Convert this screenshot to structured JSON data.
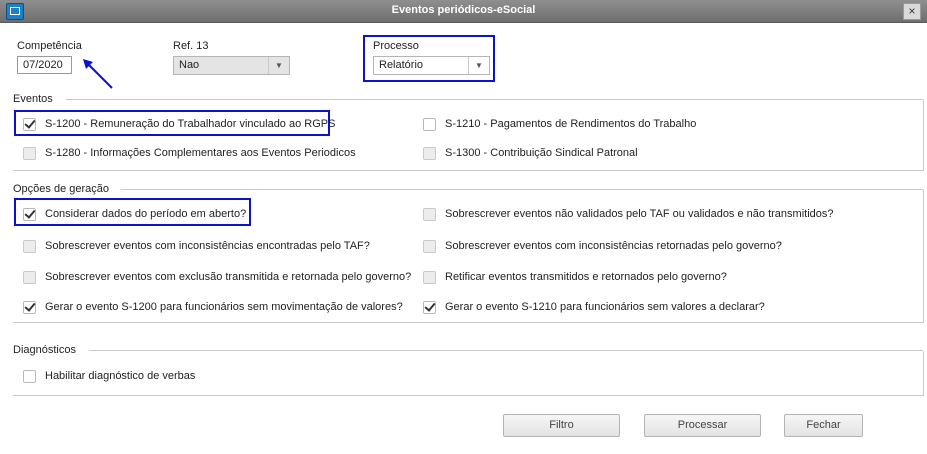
{
  "window": {
    "title": "Eventos periódicos-eSocial",
    "close_label": "×"
  },
  "fields": {
    "competencia": {
      "label": "Competência",
      "value": "07/2020"
    },
    "ref13": {
      "label": "Ref. 13",
      "value": "Nao"
    },
    "processo": {
      "label": "Processo",
      "value": "Relatório"
    }
  },
  "sections": {
    "eventos": {
      "title": "Eventos",
      "items": [
        {
          "label": "S-1200 - Remuneração do Trabalhador vinculado ao RGPS",
          "checked": true,
          "enabled": true
        },
        {
          "label": "S-1210 - Pagamentos de Rendimentos do Trabalho",
          "checked": false,
          "enabled": true
        },
        {
          "label": "S-1280 - Informações Complementares aos Eventos Periodicos",
          "checked": false,
          "enabled": false
        },
        {
          "label": "S-1300 - Contribuição Sindical Patronal",
          "checked": false,
          "enabled": false
        }
      ]
    },
    "opcoes": {
      "title": "Opções de geração",
      "items": [
        {
          "label": "Considerar dados do período em aberto?",
          "checked": true,
          "enabled": true
        },
        {
          "label": "Sobrescrever eventos não validados pelo TAF ou validados e não transmitidos?",
          "checked": false,
          "enabled": false
        },
        {
          "label": "Sobrescrever eventos com inconsistências encontradas pelo TAF?",
          "checked": false,
          "enabled": false
        },
        {
          "label": "Sobrescrever eventos com inconsistências retornadas pelo governo?",
          "checked": false,
          "enabled": false
        },
        {
          "label": "Sobrescrever eventos com exclusão transmitida e retornada pelo governo?",
          "checked": false,
          "enabled": false
        },
        {
          "label": "Retificar eventos transmitidos e retornados pelo governo?",
          "checked": false,
          "enabled": false
        },
        {
          "label": "Gerar o evento S-1200 para funcionários sem movimentação de valores?",
          "checked": true,
          "enabled": true
        },
        {
          "label": "Gerar o evento S-1210 para funcionários sem valores a declarar?",
          "checked": true,
          "enabled": true
        }
      ]
    },
    "diagnosticos": {
      "title": "Diagnósticos",
      "items": [
        {
          "label": "Habilitar diagnóstico de verbas",
          "checked": false,
          "enabled": true
        }
      ]
    }
  },
  "buttons": {
    "filtro": "Filtro",
    "processar": "Processar",
    "fechar": "Fechar"
  },
  "colors": {
    "highlight": "#0b13c8",
    "titlebar": "#7d7d7d"
  }
}
